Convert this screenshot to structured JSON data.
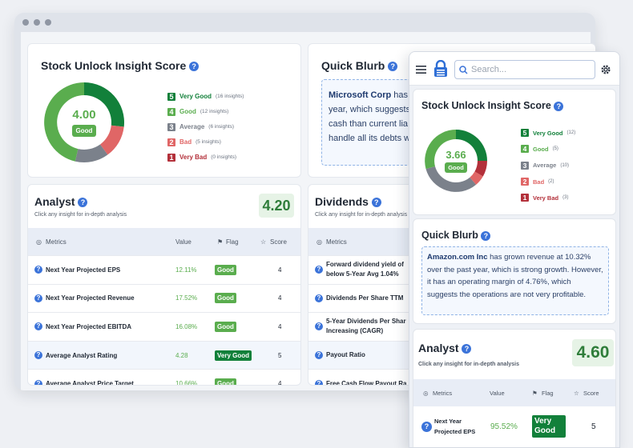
{
  "desktop": {
    "score_card": {
      "title": "Stock Unlock Insight Score",
      "score": "4.00",
      "badge": "Good",
      "legend": [
        {
          "num": "5",
          "label": "Very Good",
          "count": "(16 insights)",
          "color": "#12803a"
        },
        {
          "num": "4",
          "label": "Good",
          "count": "(12 insights)",
          "color": "#5aad4e"
        },
        {
          "num": "3",
          "label": "Average",
          "count": "(6 insights)",
          "color": "#7b818b"
        },
        {
          "num": "2",
          "label": "Bad",
          "count": "(5 insights)",
          "color": "#e06666"
        },
        {
          "num": "1",
          "label": "Very Bad",
          "count": "(0 insights)",
          "color": "#b3303a"
        }
      ]
    },
    "blurb": {
      "title": "Quick Blurb",
      "company": "Microsoft Corp",
      "line1": "has g",
      "line2": "year, which suggests",
      "line3": "cash than current lia",
      "line4": "handle all its debts w"
    },
    "analyst": {
      "title": "Analyst",
      "subtitle": "Click any insight for in-depth analysis",
      "score": "4.20",
      "headers": {
        "metrics": "Metrics",
        "value": "Value",
        "flag": "Flag",
        "score": "Score"
      },
      "rows": [
        {
          "name": "Next Year Projected EPS",
          "value": "12.11%",
          "flag": "Good",
          "score": "4"
        },
        {
          "name": "Next Year Projected Revenue",
          "value": "17.52%",
          "flag": "Good",
          "score": "4"
        },
        {
          "name": "Next Year Projected EBITDA",
          "value": "16.08%",
          "flag": "Good",
          "score": "4"
        },
        {
          "name": "Average Analyst Rating",
          "value": "4.28",
          "flag": "Very Good",
          "score": "5"
        },
        {
          "name": "Average Analyst Price Target",
          "value": "10.66%",
          "flag": "Good",
          "score": "4"
        }
      ]
    },
    "dividends": {
      "title": "Dividends",
      "subtitle": "Click any insight for in-depth analysis",
      "metrics_header": "Metrics",
      "rows": [
        {
          "line1": "Forward dividend yield of",
          "line2": "below 5-Year Avg 1.04%"
        },
        {
          "line1": "Dividends Per Share TTM",
          "line2": ""
        },
        {
          "line1": "5-Year Dividends Per Shar",
          "line2": "Increasing (CAGR)"
        },
        {
          "line1": "Payout Ratio",
          "line2": ""
        },
        {
          "line1": "Free Cash Flow Payout Ra",
          "line2": ""
        }
      ]
    }
  },
  "mobile": {
    "search_placeholder": "Search...",
    "score_card": {
      "title": "Stock Unlock Insight Score",
      "score": "3.66",
      "badge": "Good",
      "legend": [
        {
          "num": "5",
          "label": "Very Good",
          "count": "(12)",
          "color": "#12803a"
        },
        {
          "num": "4",
          "label": "Good",
          "count": "(5)",
          "color": "#5aad4e"
        },
        {
          "num": "3",
          "label": "Average",
          "count": "(10)",
          "color": "#7b818b"
        },
        {
          "num": "2",
          "label": "Bad",
          "count": "(2)",
          "color": "#e06666"
        },
        {
          "num": "1",
          "label": "Very Bad",
          "count": "(3)",
          "color": "#b3303a"
        }
      ]
    },
    "blurb": {
      "title": "Quick Blurb",
      "company": "Amazon.com Inc",
      "text": "has grown revenue at 10.32% over the past year, which is strong growth. However, it has an operating margin of 4.76%, which suggests the operations are not very profitable."
    },
    "analyst": {
      "title": "Analyst",
      "subtitle": "Click any insight for in-depth analysis",
      "score": "4.60",
      "headers": {
        "metrics": "Metrics",
        "value": "Value",
        "flag": "Flag",
        "score": "Score"
      },
      "rows": [
        {
          "name_line1": "Next Year",
          "name_line2": "Projected EPS",
          "value": "95.52%",
          "flag_line1": "Very",
          "flag_line2": "Good",
          "score": "5"
        }
      ]
    }
  }
}
